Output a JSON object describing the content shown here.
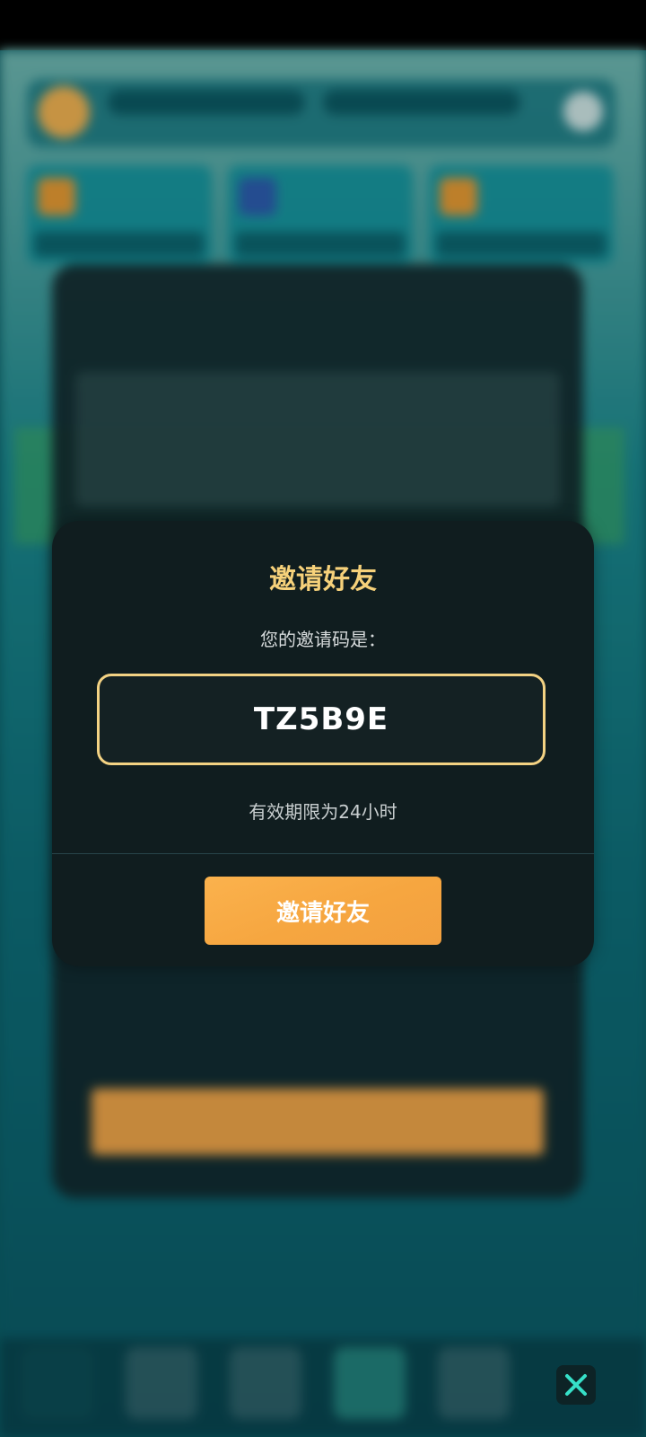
{
  "modal": {
    "title": "邀请好友",
    "subtitle": "您的邀请码是：",
    "code": "TZ5B9E",
    "validity": "有效期限为24小时",
    "invite_button": "邀请好友"
  },
  "colors": {
    "modal_bg": "#101d1f",
    "title": "#f6d17a",
    "code_border": "#f3d283",
    "button": "#f6a640",
    "close_icon": "#36e0c8"
  },
  "icons": {
    "close": "close-icon"
  }
}
